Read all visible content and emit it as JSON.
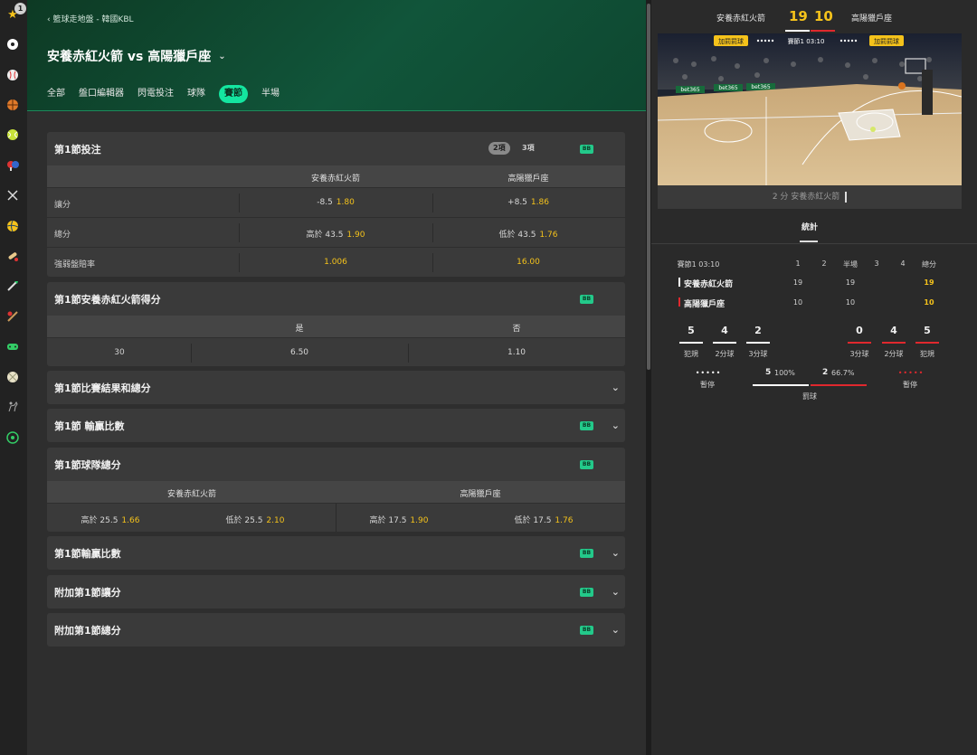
{
  "rail": {
    "badge_count": "1"
  },
  "header": {
    "breadcrumb": "‹ 籃球走地盤 - 韓國KBL",
    "title": "安養赤紅火箭 vs 高陽獵戶座",
    "tabs": [
      "全部",
      "盤口編輯器",
      "閃電投注",
      "球隊",
      "賽節",
      "半場"
    ],
    "active_tab": "賽節"
  },
  "markets": {
    "q1_bets": {
      "title": "第1節投注",
      "pill_2": "2項",
      "pill_3": "3項",
      "col_home": "安養赤紅火箭",
      "col_away": "高陽獵戶座",
      "rows": [
        {
          "label": "讓分",
          "home_line": "-8.5",
          "home_odds": "1.80",
          "away_line": "+8.5",
          "away_odds": "1.86"
        },
        {
          "label": "總分",
          "home_line": "高於 43.5",
          "home_odds": "1.90",
          "away_line": "低於 43.5",
          "away_odds": "1.76"
        },
        {
          "label": "強弱盤賠率",
          "home_line": "",
          "home_odds": "1.006",
          "away_line": "",
          "away_odds": "16.00"
        }
      ]
    },
    "q1_home_points": {
      "title": "第1節安養赤紅火箭得分",
      "col_yes": "是",
      "col_no": "否",
      "line": "30",
      "yes_odds": "6.50",
      "no_odds": "1.10"
    },
    "q1_result_total": {
      "title": "第1節比賽結果和總分"
    },
    "q1_winning_margin": {
      "title": "第1節 輸贏比數"
    },
    "q1_team_totals": {
      "title": "第1節球隊總分",
      "col_home": "安養赤紅火箭",
      "col_away": "高陽獵戶座",
      "home_over": "高於 25.5",
      "home_over_odds": "1.66",
      "home_under": "低於 25.5",
      "home_under_odds": "2.10",
      "away_over": "高於 17.5",
      "away_over_odds": "1.90",
      "away_under": "低於 17.5",
      "away_under_odds": "1.76"
    },
    "q1_margin2": {
      "title": "第1節輸贏比數"
    },
    "extra_q1_spread": {
      "title": "附加第1節讓分"
    },
    "extra_q1_total": {
      "title": "附加第1節總分"
    },
    "bb_label": "BB"
  },
  "scoreboard": {
    "home_team": "安養赤紅火箭",
    "home_score": "19",
    "away_score": "10",
    "away_team": "高陽獵戶座",
    "pitch_left_tag": "加罰罰球",
    "pitch_right_tag": "加罰罰球",
    "pitch_clock": "賽節1 03:10",
    "ad_board": "bet365",
    "last_event": "2 分 安養赤紅火箭"
  },
  "stats": {
    "tab_label": "統計",
    "period_label": "賽節1 03:10",
    "col_headers": [
      "1",
      "2",
      "半場",
      "3",
      "4",
      "總分"
    ],
    "home": {
      "name": "安養赤紅火箭",
      "q1": "19",
      "half": "19",
      "total": "19"
    },
    "away": {
      "name": "高陽獵戶座",
      "q1": "10",
      "half": "10",
      "total": "10"
    },
    "home_counts": [
      {
        "value": "5",
        "label": "犯規"
      },
      {
        "value": "4",
        "label": "2分球"
      },
      {
        "value": "2",
        "label": "3分球"
      }
    ],
    "away_counts": [
      {
        "value": "0",
        "label": "3分球"
      },
      {
        "value": "4",
        "label": "2分球"
      },
      {
        "value": "5",
        "label": "犯規"
      }
    ],
    "home_timeout_label": "暫停",
    "away_timeout_label": "暫停",
    "ft_home": "5",
    "ft_home_pct": "100%",
    "ft_away": "2",
    "ft_away_pct": "66.7%",
    "ft_label": "罰球"
  },
  "colors": {
    "accent": "#14e6a0",
    "odds": "#f4c21b",
    "home": "#ffffff",
    "away": "#e0282e"
  }
}
